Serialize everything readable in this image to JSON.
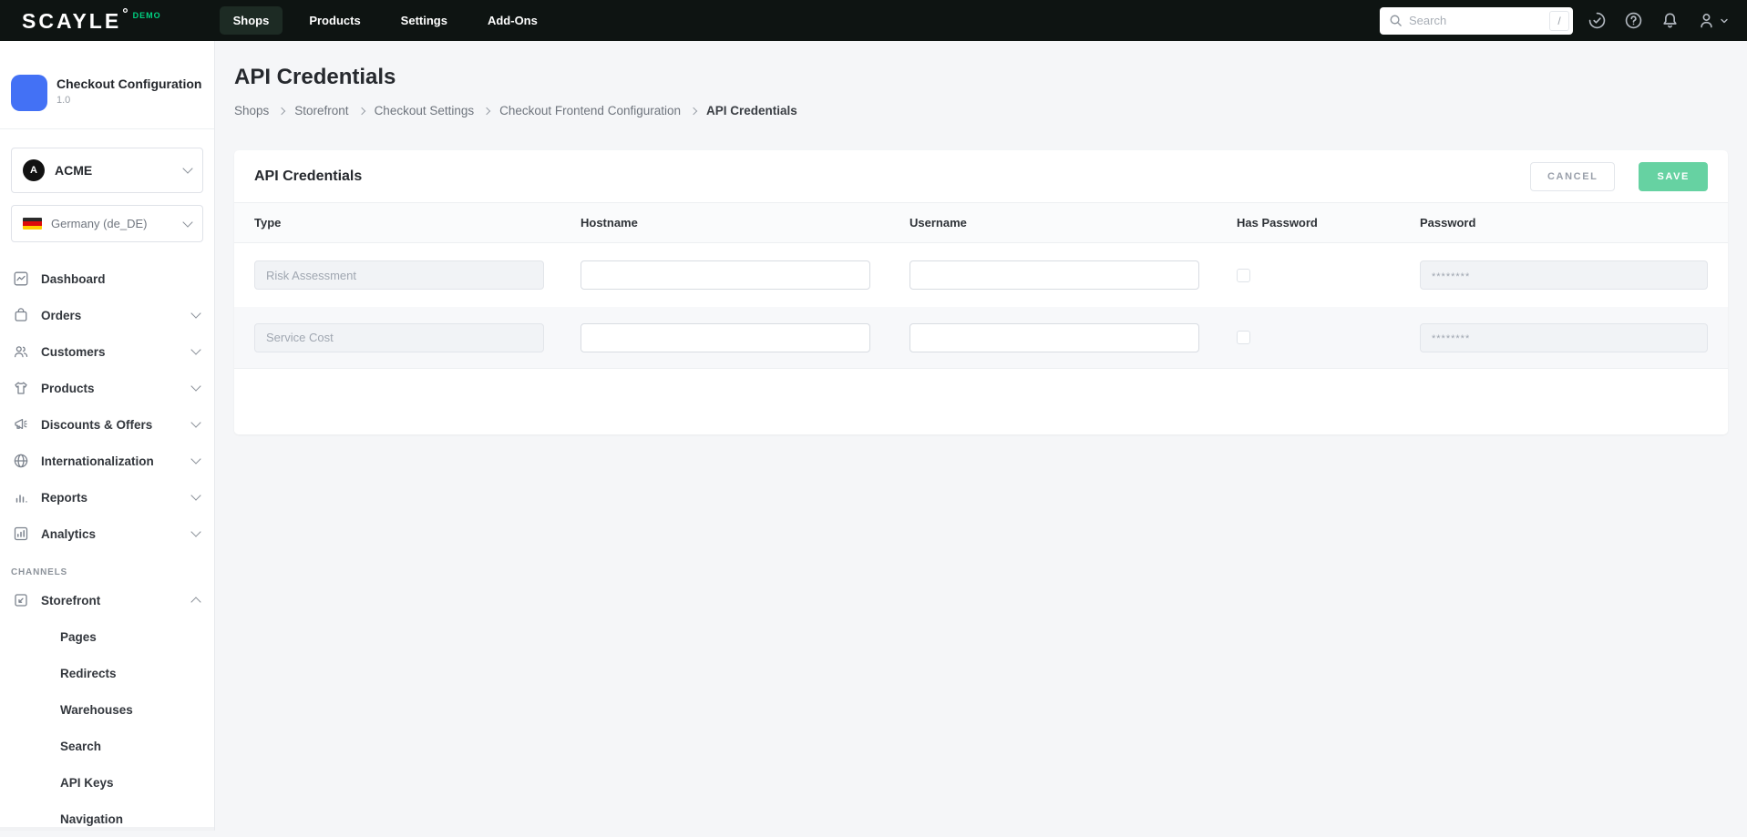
{
  "colors": {
    "topbar-bg": "#0e1412",
    "active-tab-bg": "#1d2b24",
    "demo-green": "#00d181",
    "app-icon-blue": "#4371f5",
    "save-green": "#66d2a2",
    "page-bg": "#f5f6f8"
  },
  "topbar": {
    "logo_text": "SCAYLE",
    "logo_mark": "°",
    "demo_badge": "DEMO",
    "nav": [
      {
        "label": "Shops"
      },
      {
        "label": "Products"
      },
      {
        "label": "Settings"
      },
      {
        "label": "Add-Ons"
      }
    ],
    "search": {
      "placeholder": "Search",
      "shortcut_key": "/"
    }
  },
  "sidebar": {
    "app": {
      "title": "Checkout Configuration ...",
      "version": "1.0"
    },
    "shop_selector": {
      "initial": "A",
      "label": "ACME"
    },
    "locale_selector": {
      "label": "Germany (de_DE)"
    },
    "menu": [
      {
        "label": "Dashboard"
      },
      {
        "label": "Orders"
      },
      {
        "label": "Customers"
      },
      {
        "label": "Products"
      },
      {
        "label": "Discounts & Offers"
      },
      {
        "label": "Internationalization"
      },
      {
        "label": "Reports"
      },
      {
        "label": "Analytics"
      }
    ],
    "section_label": "CHANNELS",
    "channel": {
      "label": "Storefront",
      "children": [
        {
          "label": "Pages"
        },
        {
          "label": "Redirects"
        },
        {
          "label": "Warehouses"
        },
        {
          "label": "Search"
        },
        {
          "label": "API Keys"
        },
        {
          "label": "Navigation"
        }
      ]
    }
  },
  "main": {
    "page_title": "API Credentials",
    "breadcrumb": [
      {
        "label": "Shops"
      },
      {
        "label": "Storefront"
      },
      {
        "label": "Checkout Settings"
      },
      {
        "label": "Checkout Frontend Configuration"
      },
      {
        "label": "API Credentials"
      }
    ],
    "card": {
      "title": "API Credentials",
      "cancel_label": "CANCEL",
      "save_label": "SAVE",
      "columns": [
        "Type",
        "Hostname",
        "Username",
        "Has Password",
        "Password"
      ],
      "rows": [
        {
          "type": "Risk Assessment",
          "hostname": "",
          "username": "",
          "has_password": false,
          "password_placeholder": "********"
        },
        {
          "type": "Service Cost",
          "hostname": "",
          "username": "",
          "has_password": false,
          "password_placeholder": "********"
        }
      ]
    }
  }
}
